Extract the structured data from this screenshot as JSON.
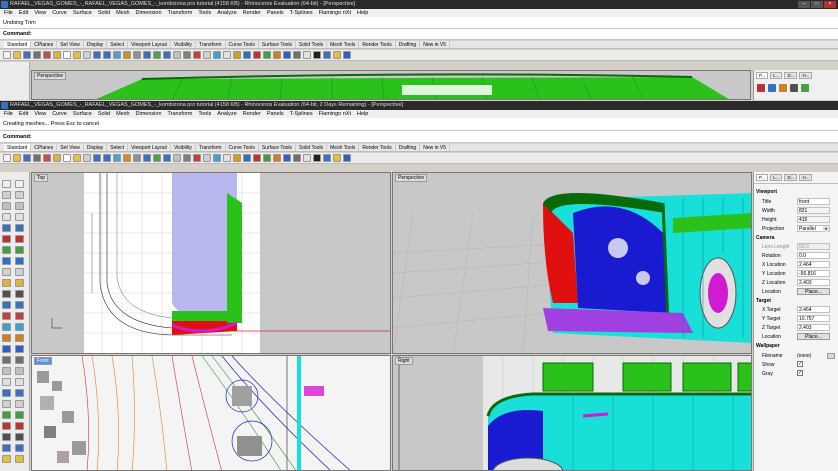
{
  "window1": {
    "title": "RAFAEL_VEGAS_GOMES_-_RAFAEL_VEGAS_GOMES_-_kombizona pro tutorial (4158 KB) - Rhinoceros Evaluation (64-bit) - [Perspective]",
    "command_history": "Undoing Trim",
    "command_label": "Command:",
    "viewport_label": "Perspective"
  },
  "window2": {
    "title": "RAFAEL_VEGAS_GOMES_-_RAFAEL_VEGAS_GOMES_-_kombizona pro tutorial (4158 KB) - Rhinoceros Evaluation (64-bit, 2 Days Remaining) - [Perspective]",
    "command_history": "Creating meshes... Press Esc to cancel",
    "command_label": "Command:"
  },
  "menu": [
    "File",
    "Edit",
    "View",
    "Curve",
    "Surface",
    "Solid",
    "Mesh",
    "Dimension",
    "Transform",
    "Tools",
    "Analyze",
    "Render",
    "Panels",
    "T-Splines",
    "Flamingo nXt",
    "Help"
  ],
  "toolbar_tabs": [
    "Standard",
    "CPlanes",
    "Set View",
    "Display",
    "Select",
    "Viewport Layout",
    "Visibility",
    "Transform",
    "Curve Tools",
    "Surface Tools",
    "Solid Tools",
    "Mesh Tools",
    "Render Tools",
    "Drafting",
    "New in V5"
  ],
  "viewports": {
    "top": "Top",
    "perspective": "Perspective",
    "front": "Front",
    "right": "Right"
  },
  "panel_tabs": [
    "P...",
    "L...",
    "D...",
    "H..."
  ],
  "properties": {
    "viewport_section": "Viewport",
    "title_label": "Title",
    "title_value": "front",
    "width_label": "Width",
    "width_value": "821",
    "height_label": "Height",
    "height_value": "415",
    "projection_label": "Projection",
    "projection_value": "Parallel",
    "camera_section": "Camera",
    "lens_label": "Lens Length",
    "lens_value": "50.0",
    "rotation_label": "Rotation",
    "rotation_value": "0.0",
    "xloc_label": "X Location",
    "xloc_value": "2.464",
    "yloc_label": "Y Location",
    "yloc_value": "-56.816",
    "zloc_label": "Z Location",
    "zloc_value": "2.403",
    "location_label": "Location",
    "place_label": "Place...",
    "target_section": "Target",
    "xtgt_label": "X Target",
    "xtgt_value": "2.464",
    "ytgt_label": "Y Target",
    "ytgt_value": "10.757",
    "ztgt_label": "Z Target",
    "ztgt_value": "2.403",
    "tlocation_label": "Location",
    "tplace_label": "Place...",
    "wallpaper_section": "Wallpaper",
    "filename_label": "Filename",
    "filename_value": "(none)",
    "show_label": "Show",
    "gray_label": "Gray"
  },
  "colors": {
    "viewport_bg": "#c8c8c8",
    "model_green": "#2ac21a",
    "model_cyan": "#18e0d8",
    "model_blue": "#1a1ad0",
    "model_red": "#e01010",
    "model_magenta": "#d21ad2"
  }
}
